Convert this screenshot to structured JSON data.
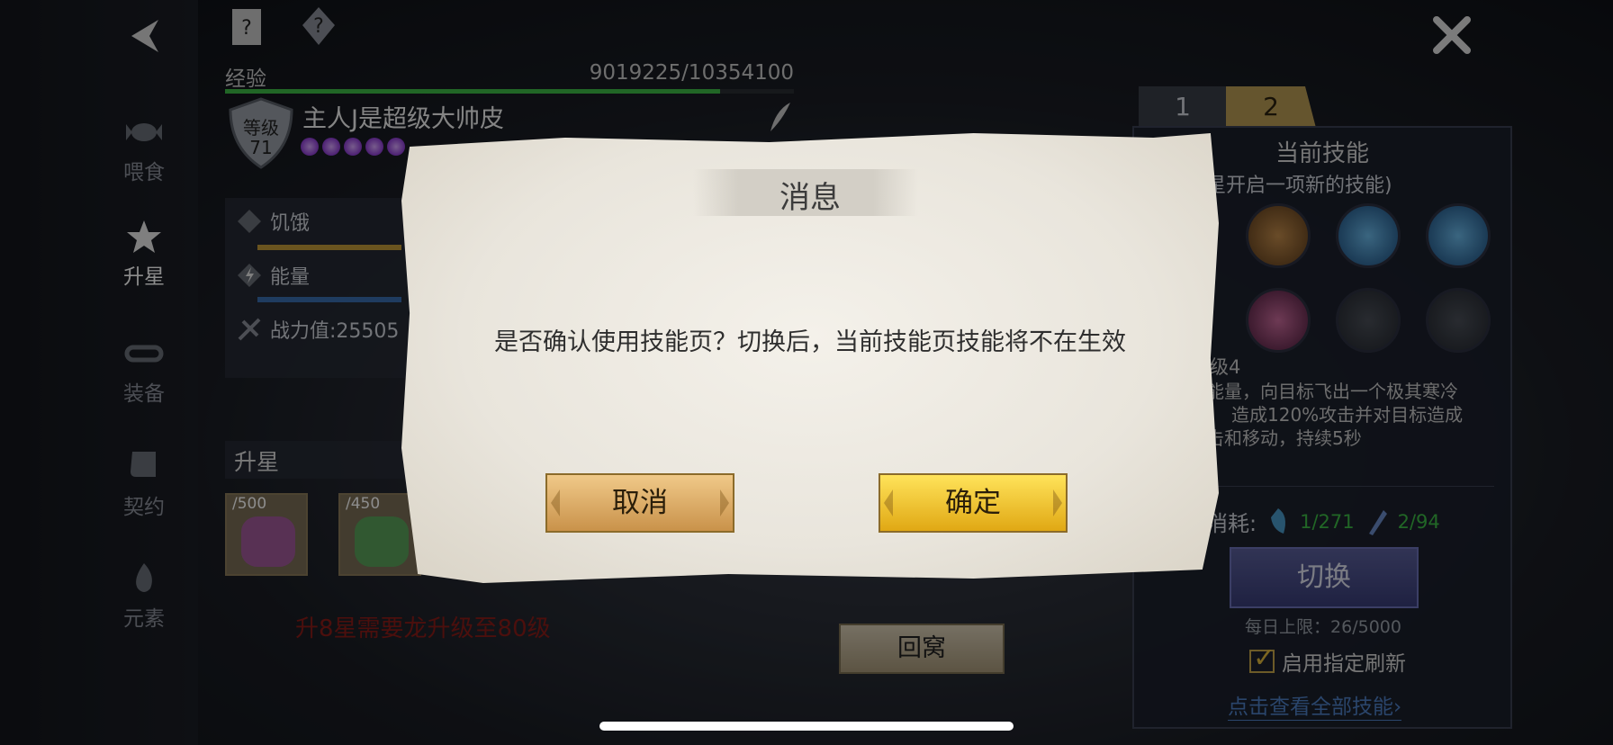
{
  "nav": {
    "items": [
      {
        "label": "喂食",
        "icon": "candy-icon"
      },
      {
        "label": "升星",
        "icon": "star-icon"
      },
      {
        "label": "装备",
        "icon": "collar-icon"
      },
      {
        "label": "契约",
        "icon": "scroll-icon"
      },
      {
        "label": "元素",
        "icon": "flame-icon"
      }
    ],
    "active_index": 1
  },
  "pet": {
    "exp_label": "经验",
    "exp_value": "9019225/10354100",
    "exp_fraction": 0.87,
    "level_label": "等级",
    "level_value": "71",
    "name": "主人J是超级大帅皮",
    "star_count": 5
  },
  "stats": {
    "hunger_label": "饥饿",
    "energy_label": "能量",
    "power_label": "战力值:25505"
  },
  "upstar": {
    "title": "升星",
    "materials": [
      {
        "count": "/500",
        "color": "#a05a9a"
      },
      {
        "count": "/450",
        "color": "#5aa05a"
      }
    ],
    "warning": "升8星需要龙升级至80级"
  },
  "skills_panel": {
    "tab1": "1",
    "tab2": "2",
    "title": "当前技能",
    "subtitle": "星开启一项新的技能)",
    "level": "级4",
    "desc_line1": "能量，向目标飞出一个极其寒冷",
    "desc_line2": "造成120%攻击并对目标造成",
    "desc_line3": "击和移动，持续5秒",
    "cost_label": "消耗:",
    "cost1": "1/271",
    "cost2": "2/94",
    "switch_label": "切换",
    "daily_limit": "每日上限：26/5000",
    "refresh_label": "启用指定刷新",
    "view_all": "点击查看全部技能"
  },
  "home_button": "回窝",
  "dialog": {
    "title": "消息",
    "message": "是否确认使用技能页？切换后，当前技能页技能将不在生效",
    "cancel": "取消",
    "confirm": "确定"
  },
  "colors": {
    "accent_gold": "#e0b93d",
    "exp_green": "#3dbb45",
    "link_blue": "#4d7fc4",
    "warning_red": "#8a1d18"
  }
}
